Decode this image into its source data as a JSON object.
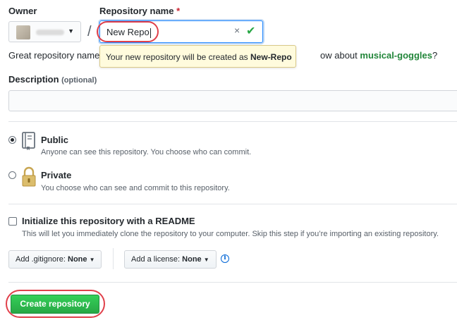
{
  "owner": {
    "label": "Owner"
  },
  "repo": {
    "label": "Repository name",
    "required_mark": "*",
    "value": "New Repo",
    "separator": "/"
  },
  "hint": {
    "prefix": "Great repository name",
    "suffix": "ow about",
    "suggestion": "musical-goggles",
    "end": "?"
  },
  "tooltip": {
    "text": "Your new repository will be created as",
    "name": "New-Repo"
  },
  "description": {
    "label": "Description",
    "optional": "(optional)",
    "value": ""
  },
  "visibility": {
    "public": {
      "title": "Public",
      "desc": "Anyone can see this repository. You choose who can commit.",
      "selected": true
    },
    "private": {
      "title": "Private",
      "desc": "You choose who can see and commit to this repository.",
      "selected": false
    }
  },
  "readme": {
    "title": "Initialize this repository with a README",
    "desc": "This will let you immediately clone the repository to your computer. Skip this step if you’re importing an existing repository.",
    "checked": false
  },
  "gitignore": {
    "prefix": "Add .gitignore:",
    "value": "None"
  },
  "license": {
    "prefix": "Add a license:",
    "value": "None"
  },
  "info_glyph": "i",
  "create_button": "Create repository",
  "colors": {
    "accent_green": "#28a745",
    "highlight_red": "#e0404a",
    "focus_blue": "#2188ff",
    "suggestion_green": "#22863a"
  }
}
